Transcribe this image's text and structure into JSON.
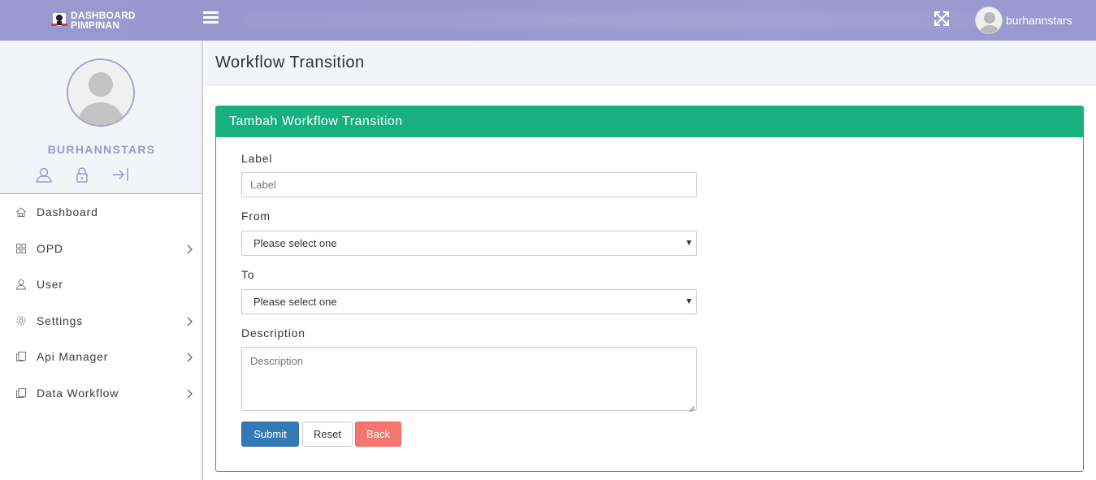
{
  "topbar": {
    "logo_line1": "DASHBOARD",
    "logo_line2": "PIMPINAN",
    "username": "burhannstars",
    "menu_icon": "hamburger-icon",
    "fullscreen_icon": "expand-icon"
  },
  "sidebar": {
    "profile_name": "BURHANNSTARS",
    "profile_icons": [
      "user-icon",
      "lock-icon",
      "logout-icon"
    ],
    "items": [
      {
        "label": "Dashboard",
        "icon": "home-icon",
        "has_children": false
      },
      {
        "label": "OPD",
        "icon": "grid-icon",
        "has_children": true
      },
      {
        "label": "User",
        "icon": "user-icon",
        "has_children": false
      },
      {
        "label": "Settings",
        "icon": "gear-icon",
        "has_children": true
      },
      {
        "label": "Api Manager",
        "icon": "documents-icon",
        "has_children": true
      },
      {
        "label": "Data Workflow",
        "icon": "documents-icon",
        "has_children": true
      }
    ]
  },
  "page": {
    "title": "Workflow Transition"
  },
  "panel": {
    "title": "Tambah Workflow Transition"
  },
  "form": {
    "label_field": {
      "label": "Label",
      "placeholder": "Label",
      "value": ""
    },
    "from_field": {
      "label": "From",
      "selected": "Please select one"
    },
    "to_field": {
      "label": "To",
      "selected": "Please select one"
    },
    "description_field": {
      "label": "Description",
      "placeholder": "Description",
      "value": ""
    },
    "buttons": {
      "submit": "Submit",
      "reset": "Reset",
      "back": "Back"
    }
  },
  "colors": {
    "topbar": "#9a98cf",
    "panel_accent": "#17b07e",
    "submit": "#337ab7",
    "back": "#f5766f",
    "profile_name": "#9b98cf"
  }
}
